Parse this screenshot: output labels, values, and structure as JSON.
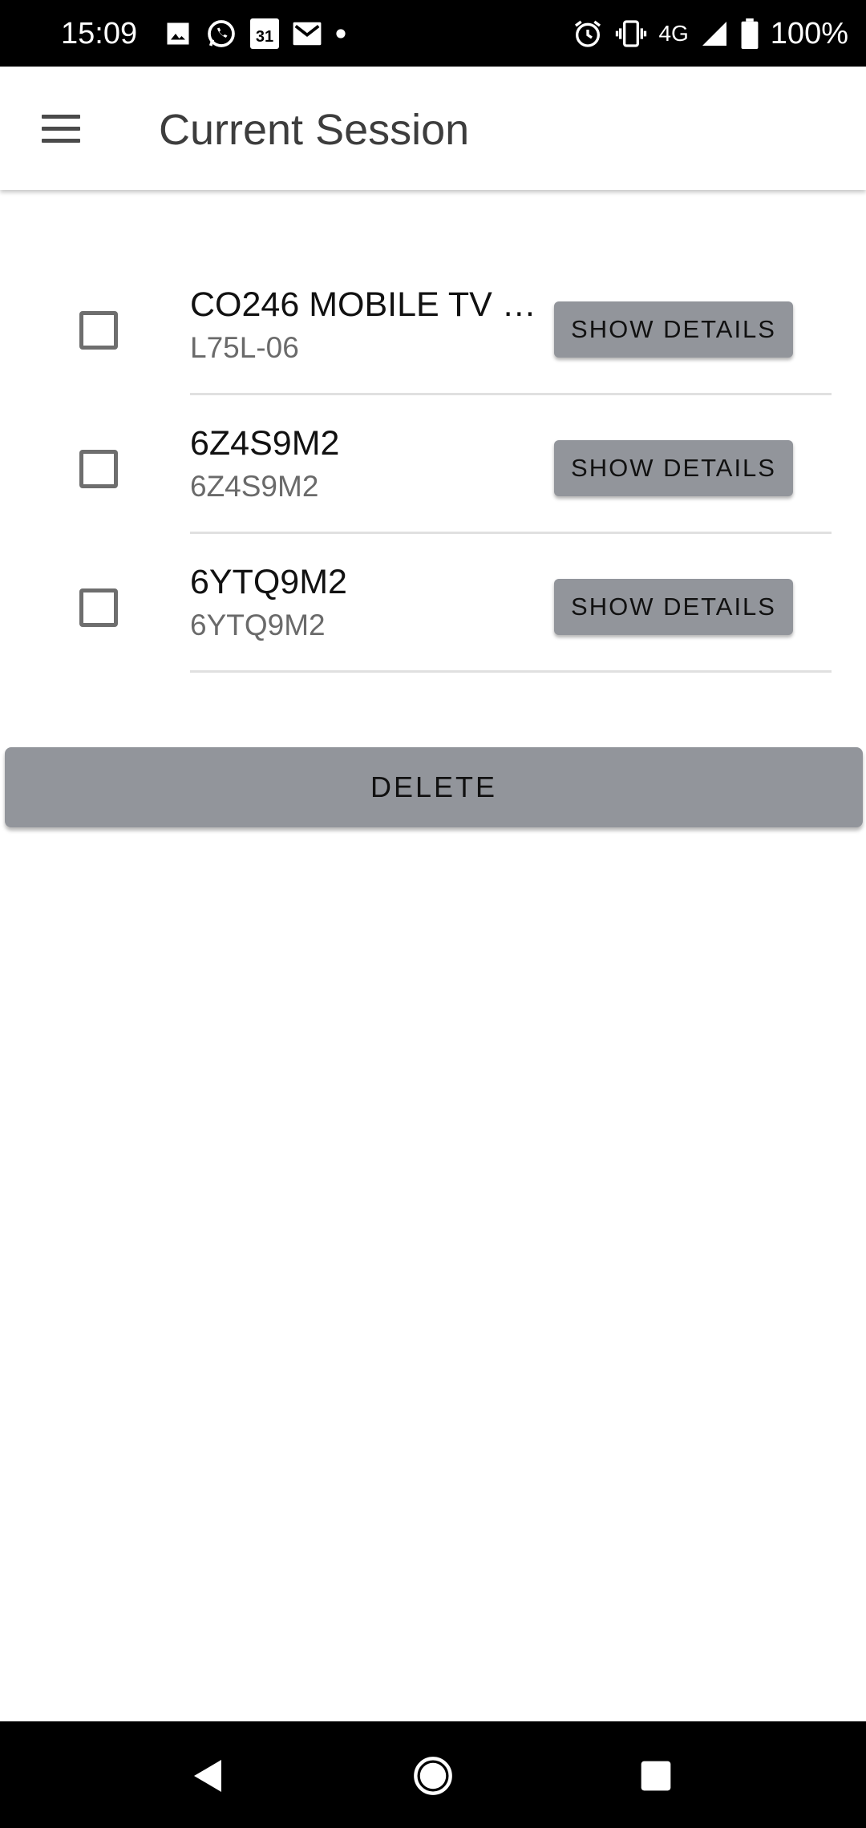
{
  "status_bar": {
    "time": "15:09",
    "network": "4G",
    "battery": "100%",
    "left_icons": [
      "image-icon",
      "whatsapp-icon",
      "calendar-icon",
      "gmail-icon",
      "dot-icon"
    ],
    "calendar_day": "31",
    "right_icons": [
      "alarm-icon",
      "vibrate-icon",
      "signal-icon",
      "battery-icon"
    ]
  },
  "app_bar": {
    "title": "Current Session",
    "menu_icon": "hamburger-menu-icon"
  },
  "items": [
    {
      "title": "CO246 MOBILE TV S…",
      "subtitle": "L75L-06",
      "checked": false,
      "button_label": "SHOW DETAILS"
    },
    {
      "title": "6Z4S9M2",
      "subtitle": "6Z4S9M2",
      "checked": false,
      "button_label": "SHOW DETAILS"
    },
    {
      "title": "6YTQ9M2",
      "subtitle": "6YTQ9M2",
      "checked": false,
      "button_label": "SHOW DETAILS"
    }
  ],
  "delete_label": "DELETE",
  "colors": {
    "button_bg": "#92959b",
    "bar_bg": "#000000"
  }
}
